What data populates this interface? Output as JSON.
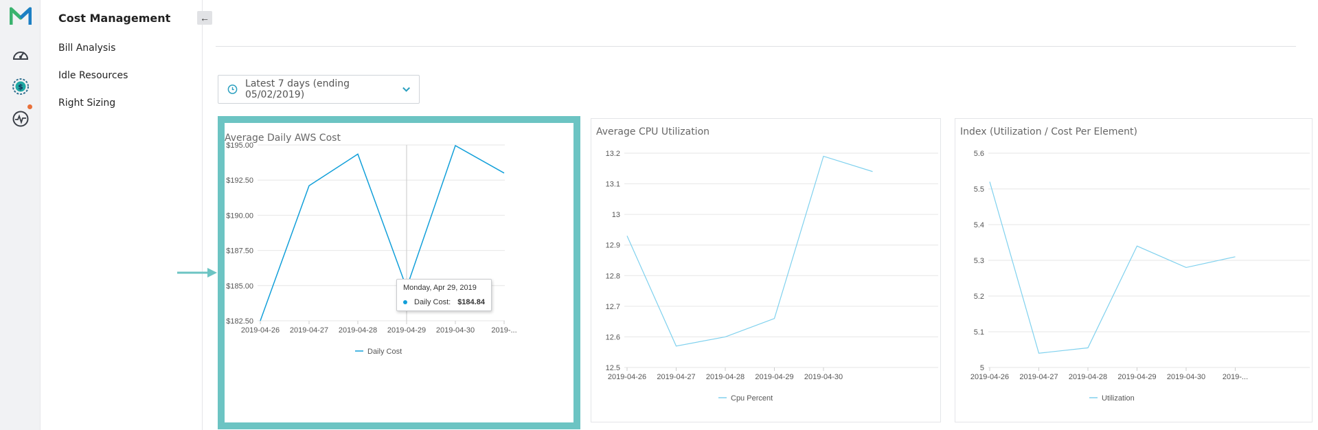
{
  "app": {
    "section_title": "Cost Management",
    "collapse_glyph": "←",
    "nav": [
      {
        "label": "Bill Analysis"
      },
      {
        "label": "Idle Resources"
      },
      {
        "label": "Right Sizing"
      }
    ],
    "rail_icons": [
      "logo-icon",
      "speedometer-icon",
      "cost-dollar-icon",
      "monitor-pulse-icon"
    ],
    "colors": {
      "brand_green": "#3ab36e",
      "brand_blue": "#1c7fc4",
      "accent_teal": "#6cc4c3",
      "notification": "#e8703a",
      "series_dark": "#119fd9",
      "series_light": "#7fd1ee"
    }
  },
  "filters": {
    "date_range_label": "Latest 7 days (ending 05/02/2019)"
  },
  "tooltip": {
    "date": "Monday, Apr 29, 2019",
    "series": "Daily Cost:",
    "value": "$184.84"
  },
  "chart_data": [
    {
      "type": "line",
      "title": "Average Daily AWS Cost",
      "x_ticks": [
        "2019-04-26",
        "2019-04-27",
        "2019-04-28",
        "2019-04-29",
        "2019-04-30",
        "2019-..."
      ],
      "x": [
        "2019-04-26",
        "2019-04-27",
        "2019-04-28",
        "2019-04-29",
        "2019-04-30",
        "2019-05-01"
      ],
      "y_ticks": [
        "$195.00",
        "$192.50",
        "$190.00",
        "$187.50",
        "$185.00",
        "$182.50"
      ],
      "ylim": [
        182.5,
        195.0
      ],
      "series": [
        {
          "name": "Daily Cost",
          "values": [
            182.5,
            192.1,
            194.35,
            184.84,
            194.95,
            193.0
          ]
        }
      ],
      "legend": "bottom",
      "grid": true
    },
    {
      "type": "line",
      "title": "Average CPU Utilization",
      "x_ticks": [
        "2019-04-26",
        "2019-04-27",
        "2019-04-28",
        "2019-04-29",
        "2019-04-30"
      ],
      "x": [
        "2019-04-26",
        "2019-04-27",
        "2019-04-28",
        "2019-04-29",
        "2019-04-30",
        "2019-05-01"
      ],
      "y_ticks": [
        "13.2",
        "13.1",
        "13",
        "12.9",
        "12.8",
        "12.7",
        "12.6",
        "12.5"
      ],
      "ylim": [
        12.5,
        13.2
      ],
      "series": [
        {
          "name": "Cpu Percent",
          "values": [
            12.93,
            12.57,
            12.6,
            12.66,
            13.19,
            13.14
          ]
        }
      ],
      "legend": "bottom",
      "grid": true
    },
    {
      "type": "line",
      "title": "Index (Utilization / Cost Per Element)",
      "x_ticks": [
        "2019-04-26",
        "2019-04-27",
        "2019-04-28",
        "2019-04-29",
        "2019-04-30",
        "2019-..."
      ],
      "x": [
        "2019-04-26",
        "2019-04-27",
        "2019-04-28",
        "2019-04-29",
        "2019-04-30",
        "2019-05-01"
      ],
      "y_ticks": [
        "5.6",
        "5.5",
        "5.4",
        "5.3",
        "5.2",
        "5.1",
        "5"
      ],
      "ylim": [
        5.0,
        5.6
      ],
      "series": [
        {
          "name": "Utilization",
          "values": [
            5.52,
            5.04,
            5.055,
            5.34,
            5.28,
            5.31
          ]
        }
      ],
      "legend": "bottom",
      "grid": true
    }
  ]
}
